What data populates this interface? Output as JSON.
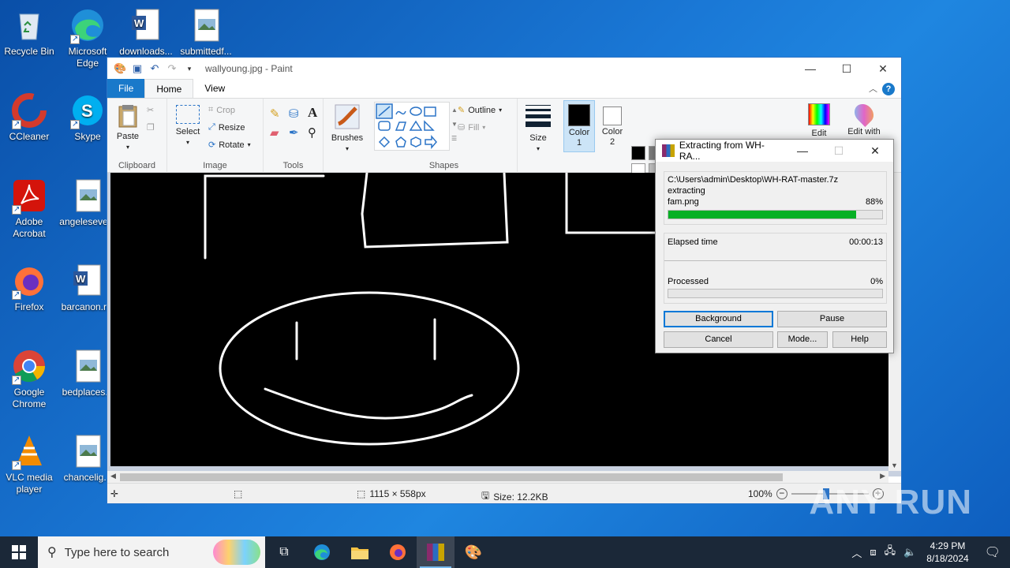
{
  "desktop": {
    "icons": [
      {
        "label": "Recycle Bin",
        "icon": "recycle-bin-icon"
      },
      {
        "label": "Microsoft Edge",
        "icon": "edge-icon"
      },
      {
        "label": "downloads...",
        "icon": "word-doc-icon"
      },
      {
        "label": "submittedf...",
        "icon": "image-file-icon"
      },
      {
        "label": "CCleaner",
        "icon": "ccleaner-icon"
      },
      {
        "label": "Skype",
        "icon": "skype-icon"
      },
      {
        "label": "Adobe Acrobat",
        "icon": "acrobat-icon"
      },
      {
        "label": "angeleseve...",
        "icon": "image-file-icon"
      },
      {
        "label": "Firefox",
        "icon": "firefox-icon"
      },
      {
        "label": "barcanon.r...",
        "icon": "word-doc-icon"
      },
      {
        "label": "Google Chrome",
        "icon": "chrome-icon"
      },
      {
        "label": "bedplaces...",
        "icon": "image-file-icon"
      },
      {
        "label": "VLC media player",
        "icon": "vlc-icon"
      },
      {
        "label": "chancelig...",
        "icon": "image-file-icon"
      }
    ]
  },
  "paint": {
    "title": "wallyoung.jpg - Paint",
    "tabs": {
      "file": "File",
      "home": "Home",
      "view": "View"
    },
    "ribbon": {
      "clipboard": {
        "label": "Clipboard",
        "paste": "Paste"
      },
      "image": {
        "label": "Image",
        "select": "Select",
        "crop": "Crop",
        "resize": "Resize",
        "rotate": "Rotate"
      },
      "tools": {
        "label": "Tools"
      },
      "brushes": {
        "label": "Brushes"
      },
      "shapes": {
        "label": "Shapes",
        "outline": "Outline",
        "fill": "Fill"
      },
      "size": {
        "label": "Size"
      },
      "color1": {
        "label": "Color 1"
      },
      "color2": {
        "label": "Color 2"
      },
      "edit_colors": "Edit",
      "edit_with": "Edit with"
    },
    "palette": [
      "#000000",
      "#7f7f7f",
      "#880015",
      "#ed1c24",
      "#ff7f27",
      "#fff200",
      "#22b14c",
      "#00a2e8",
      "#3f48cc",
      "#a349a4",
      "#ffffff",
      "#c3c3c3",
      "#b97a57",
      "#ffaec9",
      "#ffc90e",
      "#efe4b0",
      "#b5e61d",
      "#99d9ea",
      "#7092be",
      "#c8bfe7"
    ],
    "status": {
      "dimensions": "1115 × 558px",
      "size": "Size: 12.2KB",
      "zoom": "100%"
    }
  },
  "rar": {
    "title": "Extracting from WH-RA...",
    "path": "C:\\Users\\admin\\Desktop\\WH-RAT-master.7z",
    "action": "extracting",
    "file": "fam.png",
    "file_percent": "88%",
    "file_progress": 0.88,
    "elapsed_label": "Elapsed time",
    "elapsed_value": "00:00:13",
    "processed_label": "Processed",
    "processed_percent": "0%",
    "processed_progress": 0.0,
    "buttons": {
      "background": "Background",
      "pause": "Pause",
      "cancel": "Cancel",
      "mode": "Mode...",
      "help": "Help"
    }
  },
  "taskbar": {
    "search_placeholder": "Type here to search",
    "time": "4:29 PM",
    "date": "8/18/2024"
  },
  "watermark": "ANY RUN"
}
